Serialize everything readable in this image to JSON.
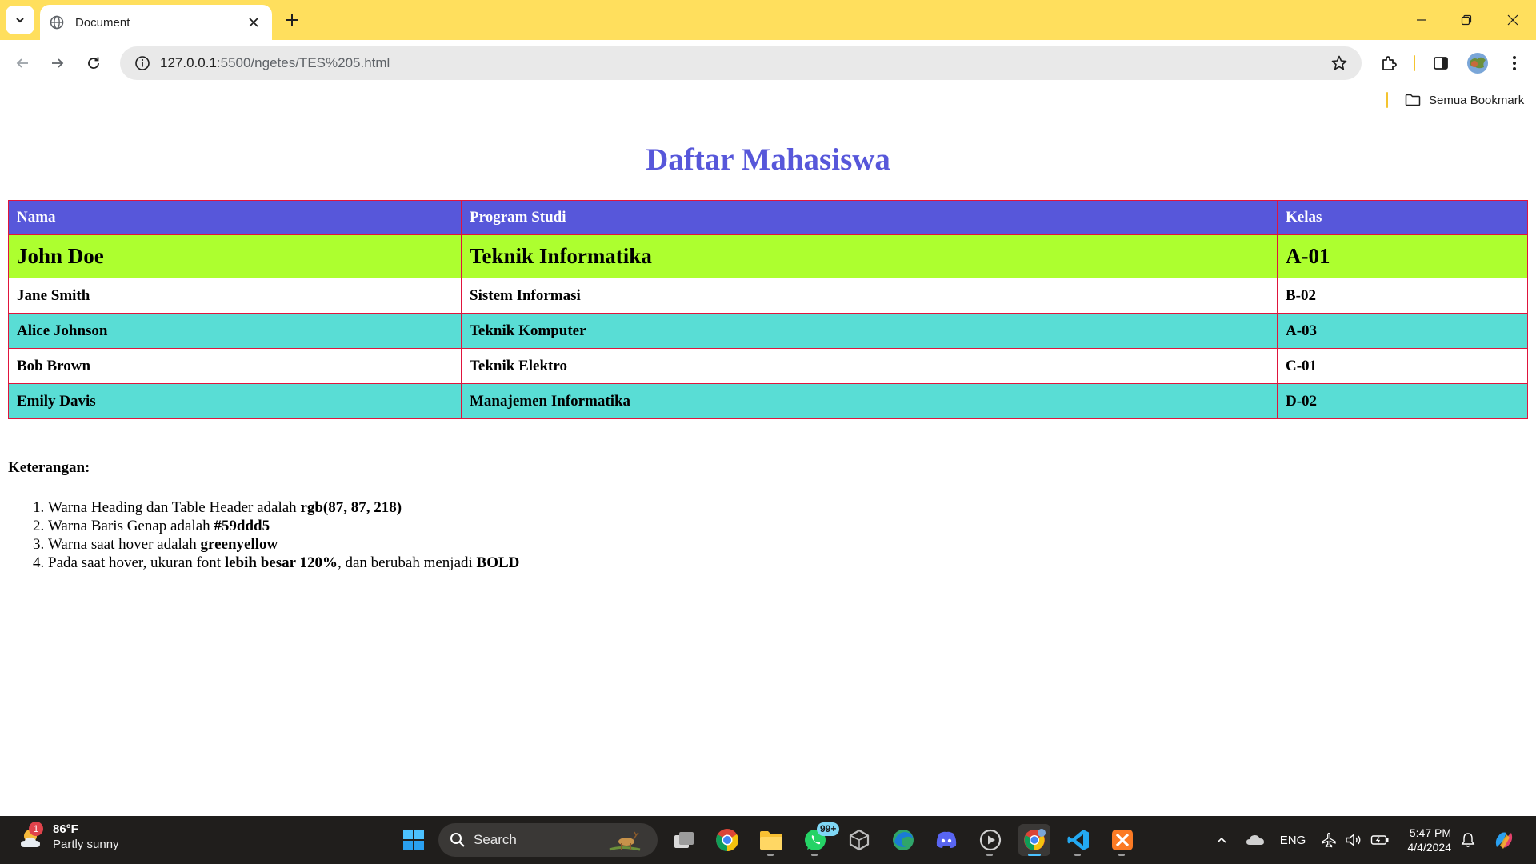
{
  "browser": {
    "tab_title": "Document",
    "url_host": "127.0.0.1",
    "url_path": ":5500/ngetes/TES%205.html",
    "bookmarks_label": "Semua Bookmark"
  },
  "page": {
    "heading": "Daftar Mahasiswa",
    "table": {
      "headers": [
        "Nama",
        "Program Studi",
        "Kelas"
      ],
      "rows": [
        [
          "John Doe",
          "Teknik Informatika",
          "A-01"
        ],
        [
          "Jane Smith",
          "Sistem Informasi",
          "B-02"
        ],
        [
          "Alice Johnson",
          "Teknik Komputer",
          "A-03"
        ],
        [
          "Bob Brown",
          "Teknik Elektro",
          "C-01"
        ],
        [
          "Emily Davis",
          "Manajemen Informatika",
          "D-02"
        ]
      ]
    },
    "keterangan_title": "Keterangan:",
    "keterangan": [
      {
        "text": "Warna Heading dan Table Header adalah ",
        "bold": "rgb(87, 87, 218)",
        "rest": "",
        "bold2": ""
      },
      {
        "text": "Warna Baris Genap adalah ",
        "bold": "#59ddd5",
        "rest": "",
        "bold2": ""
      },
      {
        "text": "Warna saat hover adalah ",
        "bold": "greenyellow",
        "rest": "",
        "bold2": ""
      },
      {
        "text": "Pada saat hover, ukuran font ",
        "bold": "lebih besar 120%",
        "rest": ", dan berubah menjadi ",
        "bold2": "BOLD"
      }
    ],
    "colors": {
      "heading": "#5757da",
      "even_row": "#59ddd5",
      "hover_row": "#adff2f",
      "border": "#e0143c"
    }
  },
  "taskbar": {
    "weather_badge": "1",
    "temperature": "86°F",
    "weather": "Partly sunny",
    "search_label": "Search",
    "whatsapp_badge": "99+",
    "language": "ENG",
    "time": "5:47 PM",
    "date": "4/4/2024"
  }
}
